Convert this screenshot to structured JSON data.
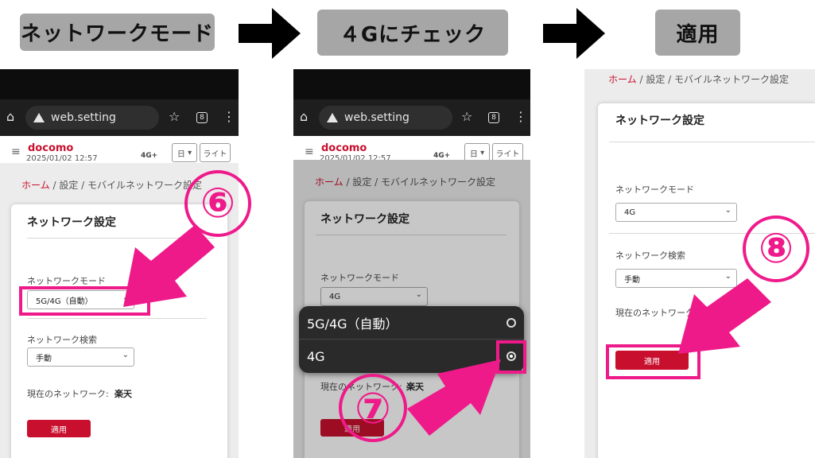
{
  "steps": {
    "step1": "ネットワークモード",
    "step2": "４Gにチェック",
    "step3": "適用"
  },
  "browser": {
    "url": "web.setting",
    "tab_count": "8"
  },
  "site": {
    "brand": "docomo",
    "datetime": "2025/01/02 12:57",
    "signal": "4G+",
    "lang_button": "日",
    "theme_button": "ライト"
  },
  "breadcrumb": {
    "home": "ホーム",
    "sep1": " / ",
    "settings": "設定",
    "sep2": " / ",
    "current": "モバイルネットワーク設定"
  },
  "card": {
    "title": "ネットワーク設定",
    "mode_label": "ネットワークモード",
    "mode_value_before": "5G/4G（自動）",
    "mode_value_after": "4G",
    "search_label": "ネットワーク検索",
    "search_value": "手動",
    "current_label": "現在のネットワーク:",
    "current_label_partial": "現在のネットワーク",
    "current_value": "楽天",
    "apply_label": "適用"
  },
  "dropdown": {
    "options": [
      "5G/4G（自動）",
      "4G"
    ],
    "selected": "4G"
  },
  "annotations": {
    "step_numbers": [
      "⑥",
      "⑦",
      "⑧"
    ],
    "accent_color": "#ef1a8a"
  },
  "colors": {
    "brand_red": "#c8102e",
    "label_bg": "#a6a6a6"
  }
}
